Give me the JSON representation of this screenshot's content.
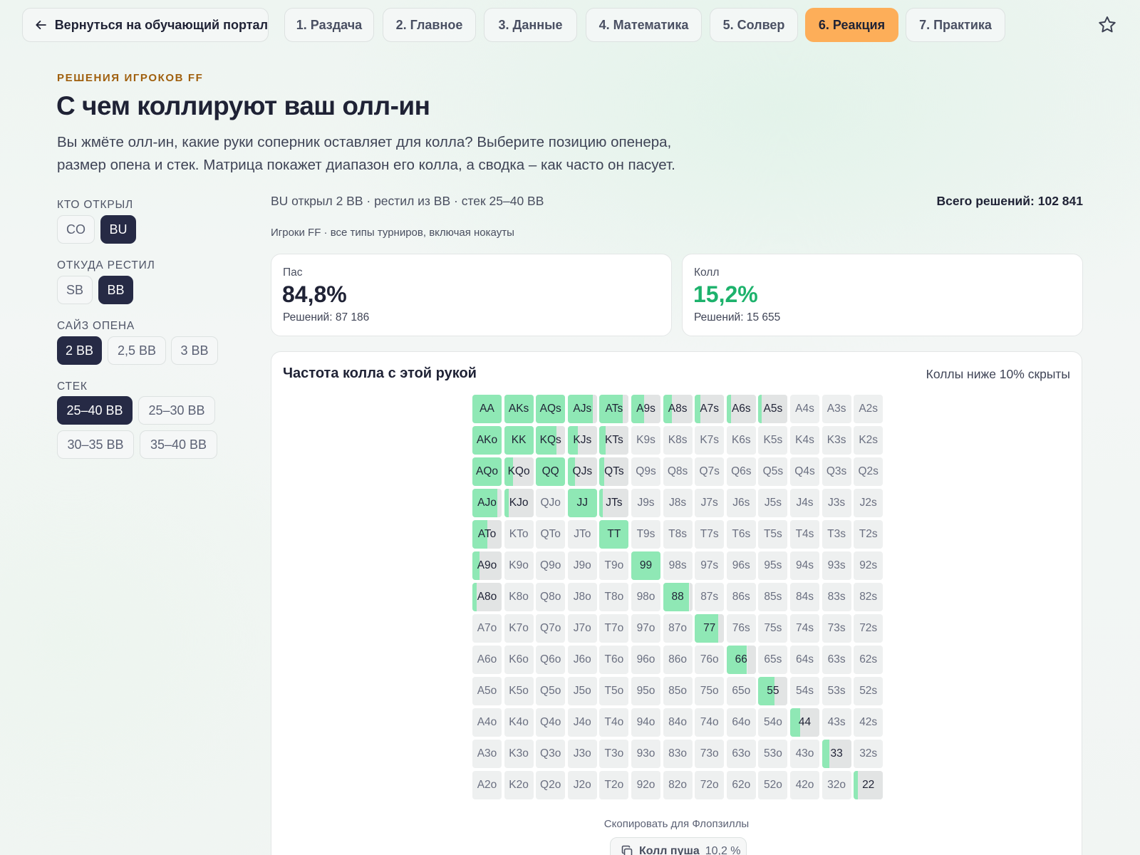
{
  "nav": {
    "back_label": "Вернуться на обучающий портал",
    "tabs": [
      {
        "label": "1. Раздача",
        "active": false
      },
      {
        "label": "2. Главное",
        "active": false
      },
      {
        "label": "3. Данные",
        "active": false
      },
      {
        "label": "4. Математика",
        "active": false
      },
      {
        "label": "5. Солвер",
        "active": false
      },
      {
        "label": "6. Реакция",
        "active": true
      },
      {
        "label": "7. Практика",
        "active": false
      }
    ],
    "icons": {
      "back": "arrow-left-icon",
      "favorite": "star-icon"
    }
  },
  "header": {
    "eyebrow": "РЕШЕНИЯ ИГРОКОВ FF",
    "title": "С чем коллируют ваш олл-ин",
    "description": "Вы жмёте олл-ин, какие руки соперник оставляет для колла? Выберите позицию опенера, размер опена и стек. Матрица покажет диапазон его колла, а сводка – как часто он пасует."
  },
  "filters": {
    "opener": {
      "label": "КТО ОТКРЫЛ",
      "options": [
        "CO",
        "BU"
      ],
      "selected": "BU"
    },
    "reraiser": {
      "label": "ОТКУДА РЕСТИЛ",
      "options": [
        "SB",
        "BB"
      ],
      "selected": "BB"
    },
    "open_size": {
      "label": "САЙЗ ОПЕНА",
      "options": [
        "2 BB",
        "2,5 BB",
        "3 BB"
      ],
      "selected": "2 BB"
    },
    "stack": {
      "label": "СТЕК",
      "options": [
        "25–40 BB",
        "25–30 BB",
        "30–35 BB",
        "35–40 BB"
      ],
      "selected": "25–40 BB"
    }
  },
  "summary": {
    "line": "BU открыл 2 BB · рестил из BB · стек 25–40 BB",
    "total": "Всего решений: 102 841",
    "sub": "Игроки FF · все типы турниров, включая нокауты"
  },
  "stats": {
    "fold": {
      "label": "Пас",
      "value": "84,8%",
      "sub": "Решений: 87 186"
    },
    "call": {
      "label": "Колл",
      "value": "15,2%",
      "sub": "Решений: 15 655"
    }
  },
  "matrix": {
    "title": "Частота колла с этой рукой",
    "note": "Коллы ниже 10% скрыты",
    "copy_text": "Скопировать для Флопзиллы",
    "copy_label": "Колл пуша",
    "copy_pct": "10,2 %",
    "copy_icon": "copy-icon",
    "colors": {
      "call": "#8fe8b5",
      "fold": "#e2e4e4",
      "empty": "#eef0f0"
    },
    "rows": [
      [
        [
          "AA",
          1
        ],
        [
          "AKs",
          1
        ],
        [
          "AQs",
          1
        ],
        [
          "AJs",
          0.85
        ],
        [
          "ATs",
          0.8
        ],
        [
          "A9s",
          0.45
        ],
        [
          "A8s",
          0.3
        ],
        [
          "A7s",
          0.18
        ],
        [
          "A6s",
          0.14
        ],
        [
          "A5s",
          0.12
        ],
        [
          "A4s",
          0
        ],
        [
          "A3s",
          0
        ],
        [
          "A2s",
          0
        ]
      ],
      [
        [
          "AKo",
          1
        ],
        [
          "KK",
          1
        ],
        [
          "KQs",
          0.7
        ],
        [
          "KJs",
          0.35
        ],
        [
          "KTs",
          0.2
        ],
        [
          "K9s",
          0
        ],
        [
          "K8s",
          0
        ],
        [
          "K7s",
          0
        ],
        [
          "K6s",
          0
        ],
        [
          "K5s",
          0
        ],
        [
          "K4s",
          0
        ],
        [
          "K3s",
          0
        ],
        [
          "K2s",
          0
        ]
      ],
      [
        [
          "AQo",
          1
        ],
        [
          "KQo",
          0.3
        ],
        [
          "QQ",
          1
        ],
        [
          "QJs",
          0.25
        ],
        [
          "QTs",
          0.15
        ],
        [
          "Q9s",
          0
        ],
        [
          "Q8s",
          0
        ],
        [
          "Q7s",
          0
        ],
        [
          "Q6s",
          0
        ],
        [
          "Q5s",
          0
        ],
        [
          "Q4s",
          0
        ],
        [
          "Q3s",
          0
        ],
        [
          "Q2s",
          0
        ]
      ],
      [
        [
          "AJo",
          0.85
        ],
        [
          "KJo",
          0.15
        ],
        [
          "QJo",
          0
        ],
        [
          "JJ",
          1
        ],
        [
          "JTs",
          0.12
        ],
        [
          "J9s",
          0
        ],
        [
          "J8s",
          0
        ],
        [
          "J7s",
          0
        ],
        [
          "J6s",
          0
        ],
        [
          "J5s",
          0
        ],
        [
          "J4s",
          0
        ],
        [
          "J3s",
          0
        ],
        [
          "J2s",
          0
        ]
      ],
      [
        [
          "ATo",
          0.5
        ],
        [
          "KTo",
          0
        ],
        [
          "QTo",
          0
        ],
        [
          "JTo",
          0
        ],
        [
          "TT",
          1
        ],
        [
          "T9s",
          0
        ],
        [
          "T8s",
          0
        ],
        [
          "T7s",
          0
        ],
        [
          "T6s",
          0
        ],
        [
          "T5s",
          0
        ],
        [
          "T4s",
          0
        ],
        [
          "T3s",
          0
        ],
        [
          "T2s",
          0
        ]
      ],
      [
        [
          "A9o",
          0.25
        ],
        [
          "K9o",
          0
        ],
        [
          "Q9o",
          0
        ],
        [
          "J9o",
          0
        ],
        [
          "T9o",
          0
        ],
        [
          "99",
          1
        ],
        [
          "98s",
          0
        ],
        [
          "97s",
          0
        ],
        [
          "96s",
          0
        ],
        [
          "95s",
          0
        ],
        [
          "94s",
          0
        ],
        [
          "93s",
          0
        ],
        [
          "92s",
          0
        ]
      ],
      [
        [
          "A8o",
          0.15
        ],
        [
          "K8o",
          0
        ],
        [
          "Q8o",
          0
        ],
        [
          "J8o",
          0
        ],
        [
          "T8o",
          0
        ],
        [
          "98o",
          0
        ],
        [
          "88",
          0.9
        ],
        [
          "87s",
          0
        ],
        [
          "86s",
          0
        ],
        [
          "85s",
          0
        ],
        [
          "84s",
          0
        ],
        [
          "83s",
          0
        ],
        [
          "82s",
          0
        ]
      ],
      [
        [
          "A7o",
          0
        ],
        [
          "K7o",
          0
        ],
        [
          "Q7o",
          0
        ],
        [
          "J7o",
          0
        ],
        [
          "T7o",
          0
        ],
        [
          "97o",
          0
        ],
        [
          "87o",
          0
        ],
        [
          "77",
          0.8
        ],
        [
          "76s",
          0
        ],
        [
          "75s",
          0
        ],
        [
          "74s",
          0
        ],
        [
          "73s",
          0
        ],
        [
          "72s",
          0
        ]
      ],
      [
        [
          "A6o",
          0
        ],
        [
          "K6o",
          0
        ],
        [
          "Q6o",
          0
        ],
        [
          "J6o",
          0
        ],
        [
          "T6o",
          0
        ],
        [
          "96o",
          0
        ],
        [
          "86o",
          0
        ],
        [
          "76o",
          0
        ],
        [
          "66",
          0.7
        ],
        [
          "65s",
          0
        ],
        [
          "64s",
          0
        ],
        [
          "63s",
          0
        ],
        [
          "62s",
          0
        ]
      ],
      [
        [
          "A5o",
          0
        ],
        [
          "K5o",
          0
        ],
        [
          "Q5o",
          0
        ],
        [
          "J5o",
          0
        ],
        [
          "T5o",
          0
        ],
        [
          "95o",
          0
        ],
        [
          "85o",
          0
        ],
        [
          "75o",
          0
        ],
        [
          "65o",
          0
        ],
        [
          "55",
          0.55
        ],
        [
          "54s",
          0
        ],
        [
          "53s",
          0
        ],
        [
          "52s",
          0
        ]
      ],
      [
        [
          "A4o",
          0
        ],
        [
          "K4o",
          0
        ],
        [
          "Q4o",
          0
        ],
        [
          "J4o",
          0
        ],
        [
          "T4o",
          0
        ],
        [
          "94o",
          0
        ],
        [
          "84o",
          0
        ],
        [
          "74o",
          0
        ],
        [
          "64o",
          0
        ],
        [
          "54o",
          0
        ],
        [
          "44",
          0.35
        ],
        [
          "43s",
          0
        ],
        [
          "42s",
          0
        ]
      ],
      [
        [
          "A3o",
          0
        ],
        [
          "K3o",
          0
        ],
        [
          "Q3o",
          0
        ],
        [
          "J3o",
          0
        ],
        [
          "T3o",
          0
        ],
        [
          "93o",
          0
        ],
        [
          "83o",
          0
        ],
        [
          "73o",
          0
        ],
        [
          "63o",
          0
        ],
        [
          "53o",
          0
        ],
        [
          "43o",
          0
        ],
        [
          "33",
          0.25
        ],
        [
          "32s",
          0
        ]
      ],
      [
        [
          "A2o",
          0
        ],
        [
          "K2o",
          0
        ],
        [
          "Q2o",
          0
        ],
        [
          "J2o",
          0
        ],
        [
          "T2o",
          0
        ],
        [
          "92o",
          0
        ],
        [
          "82o",
          0
        ],
        [
          "72o",
          0
        ],
        [
          "62o",
          0
        ],
        [
          "52o",
          0
        ],
        [
          "42o",
          0
        ],
        [
          "32o",
          0
        ],
        [
          "22",
          0.15
        ]
      ]
    ]
  }
}
